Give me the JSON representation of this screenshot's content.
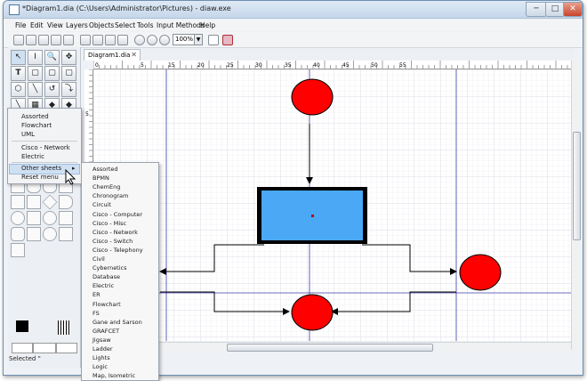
{
  "window": {
    "title": "*Diagram1.dia (C:\\Users\\Administrator\\Pictures) - diaw.exe",
    "minimize_glyph": "─",
    "maximize_glyph": "□",
    "close_glyph": "✕"
  },
  "menubar": {
    "items": [
      "File",
      "Edit",
      "View",
      "Layers",
      "Objects",
      "Select",
      "Tools",
      "Input Methods",
      "Help"
    ]
  },
  "toolbar": {
    "zoom_value": "100%",
    "zoom_dropdown_glyph": "▼"
  },
  "tabs": [
    {
      "label": "Diagram1.dia",
      "close_glyph": "✕"
    }
  ],
  "rulers": {
    "horizontal_ticks": [
      "0",
      "5",
      "15",
      "20",
      "25",
      "30",
      "35",
      "40",
      "45",
      "50",
      "55"
    ],
    "vertical_ticks": [
      "5"
    ]
  },
  "toolbox": {
    "tool_glyphs": [
      "↖",
      "I",
      "🔍",
      "✥",
      "T",
      "▢",
      "▢",
      "▢",
      "⬡",
      "╲",
      "↺",
      "⤵",
      "╲",
      "▦",
      "◆",
      "◆"
    ]
  },
  "context_menu": {
    "items": [
      "Assorted",
      "Flowchart",
      "UML",
      "Cisco - Network",
      "Electric",
      "Other sheets",
      "Reset menu"
    ],
    "submenu_arrow": "▸"
  },
  "other_sheets_submenu": {
    "items": [
      "Assorted",
      "BPMN",
      "ChemEng",
      "Chronogram",
      "Circuit",
      "Cisco - Computer",
      "Cisco - Misc",
      "Cisco - Network",
      "Cisco - Switch",
      "Cisco - Telephony",
      "Civil",
      "Cybernetics",
      "Database",
      "Electric",
      "ER",
      "Flowchart",
      "FS",
      "Gane and Sarson",
      "GRAFCET",
      "Jigsaw",
      "Ladder",
      "Lights",
      "Logic",
      "Map, Isometric"
    ]
  },
  "status": {
    "text": "Selected \""
  },
  "colors": {
    "circle_fill": "#ff0000",
    "rect_fill": "#4aa8f5",
    "guide_line": "#3b3ba8",
    "grid": "#e6e6ee"
  }
}
